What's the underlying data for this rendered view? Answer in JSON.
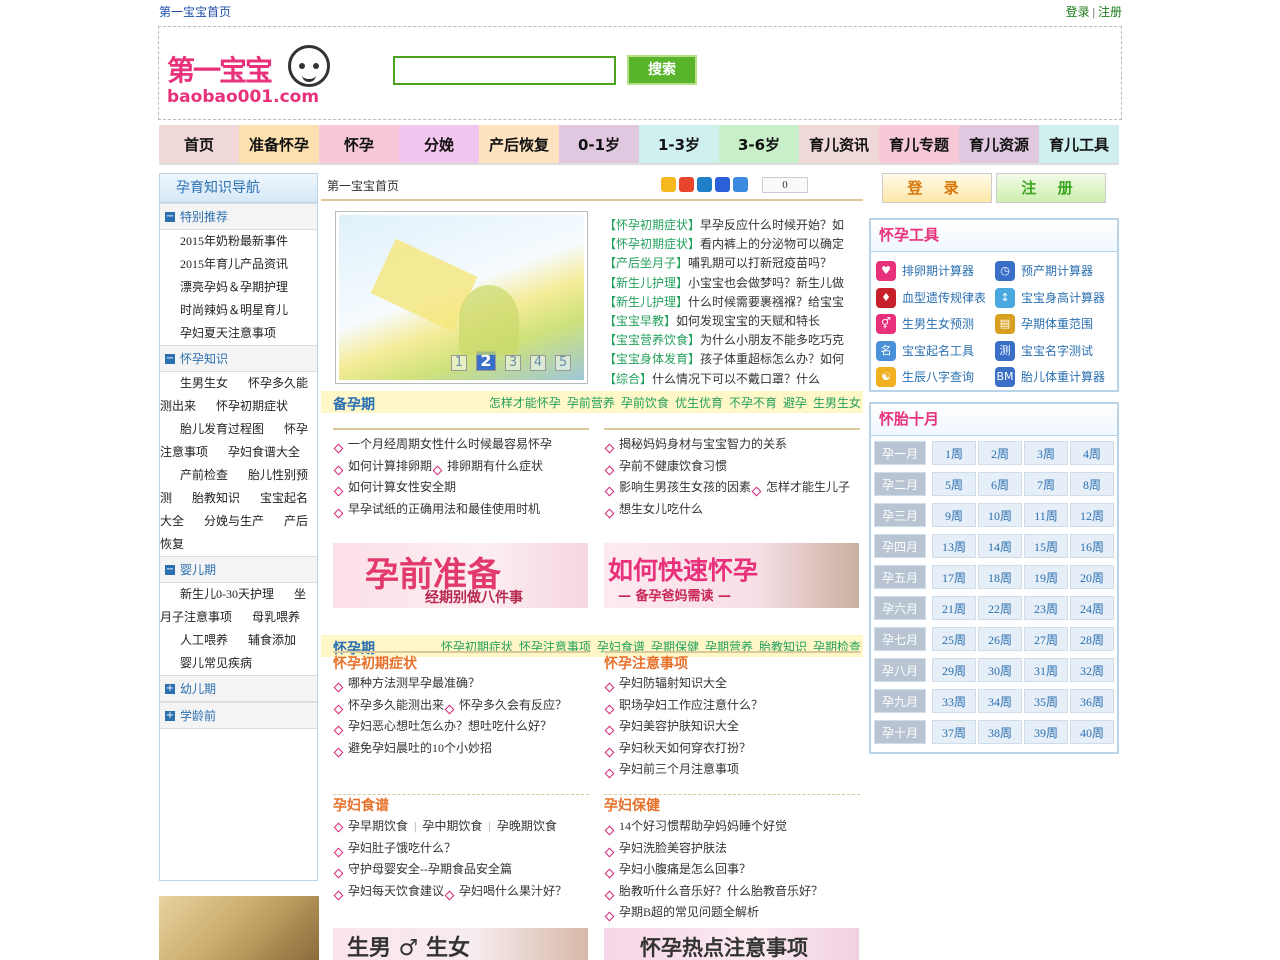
{
  "topbar": {
    "home": "第一宝宝首页",
    "login": "登录",
    "sep": "|",
    "register": "注册"
  },
  "logo": {
    "title": "第一宝宝",
    "domain": "baobao001.com"
  },
  "search": {
    "placeholder": "",
    "button": "搜索"
  },
  "nav": [
    {
      "label": "首页",
      "color": "#f0d8d8"
    },
    {
      "label": "准备怀孕",
      "color": "#fde0b0"
    },
    {
      "label": "怀孕",
      "color": "#f6c8d8"
    },
    {
      "label": "分娩",
      "color": "#f3c6ef"
    },
    {
      "label": "产后恢复",
      "color": "#fde3c0"
    },
    {
      "label": "0-1岁",
      "color": "#e0c8e0"
    },
    {
      "label": "1-3岁",
      "color": "#d0f0f0"
    },
    {
      "label": "3-6岁",
      "color": "#c8efc8"
    },
    {
      "label": "育儿资讯",
      "color": "#f0d8d8"
    },
    {
      "label": "育儿专题",
      "color": "#f6c8d8"
    },
    {
      "label": "育儿资源",
      "color": "#e0c8e0"
    },
    {
      "label": "育儿工具",
      "color": "#d0f0f0"
    }
  ],
  "leftnav": {
    "title": "孕育知识导航",
    "sections": [
      {
        "title": "特别推荐",
        "sign": "−",
        "items": [
          "2015年奶粉最新事件",
          "2015年育儿产品资讯",
          "漂亮孕妈＆孕期护理",
          "时尚辣妈＆明星育儿",
          "孕妇夏天注意事项"
        ]
      },
      {
        "title": "怀孕知识",
        "sign": "−",
        "items": [
          "生男生女",
          "怀孕多久能测出来",
          "怀孕初期症状",
          "胎儿发育过程图",
          "怀孕注意事项",
          "孕妇食谱大全",
          "产前检查",
          "胎儿性别预测",
          "胎教知识",
          "宝宝起名大全",
          "分娩与生产",
          "产后恢复"
        ]
      },
      {
        "title": "婴儿期",
        "sign": "−",
        "items": [
          "新生儿0-30天护理",
          "坐月子注意事项",
          "母乳喂养",
          "人工喂养",
          "辅食添加",
          "婴儿常见疾病"
        ]
      },
      {
        "title": "幼儿期",
        "sign": "+",
        "items": []
      },
      {
        "title": "学龄前",
        "sign": "+",
        "items": []
      }
    ]
  },
  "crumb": {
    "text": "第一宝宝首页",
    "share_count": "0"
  },
  "slider": {
    "dots": [
      "1",
      "2",
      "3",
      "4",
      "5"
    ],
    "active": "2"
  },
  "headlines": [
    {
      "tag": "【怀孕初期症状】",
      "text": "早孕反应什么时候开始？如"
    },
    {
      "tag": "【怀孕初期症状】",
      "text": "看内裤上的分泌物可以确定"
    },
    {
      "tag": "【产后坐月子】",
      "text": "哺乳期可以打新冠疫苗吗？"
    },
    {
      "tag": "【新生儿护理】",
      "text": "小宝宝也会做梦吗？新生儿做"
    },
    {
      "tag": "【新生儿护理】",
      "text": "什么时候需要裹襁褓？给宝宝"
    },
    {
      "tag": "【宝宝早教】",
      "text": "如何发现宝宝的天赋和特长"
    },
    {
      "tag": "【宝宝营养饮食】",
      "text": "为什么小朋友不能多吃巧克"
    },
    {
      "tag": "【宝宝身体发育】",
      "text": "孩子体重超标怎么办？如何"
    },
    {
      "tag": "【综合】",
      "text": "什么情况下可以不戴口罩？什么"
    }
  ],
  "prep": {
    "title": "备孕期",
    "links": [
      "怎样才能怀孕",
      "孕前营养",
      "孕前饮食",
      "优生优育",
      "不孕不育",
      "避孕",
      "生男生女"
    ],
    "left": [
      "一个月经周期女性什么时候最容易怀孕",
      "如何计算排卵期",
      "排卵期有什么症状",
      "如何计算女性安全期",
      "早孕试纸的正确用法和最佳使用时机"
    ],
    "right": [
      "揭秘妈妈身材与宝宝智力的关系",
      "孕前不健康饮食习惯",
      "影响生男孩生女孩的因素",
      "怎样才能生儿子",
      "想生女儿吃什么"
    ],
    "banner_left": {
      "title": "孕前准备",
      "sub": "经期别做八件事"
    },
    "banner_right": {
      "title": "如何快速怀孕",
      "sub": "— 备孕爸妈需读 —"
    }
  },
  "preg": {
    "title": "怀孕期",
    "links": [
      "怀孕初期症状",
      "怀孕注意事项",
      "孕妇食谱",
      "孕期保健",
      "孕期营养",
      "胎教知识",
      "孕期检查"
    ],
    "b1": {
      "title": "怀孕初期症状",
      "items": [
        "哪种方法测早孕最准确？",
        "怀孕多久能测出来",
        "怀孕多久会有反应？",
        "孕妇恶心想吐怎么办？想吐吃什么好？",
        "避免孕妇晨吐的10个小妙招"
      ]
    },
    "b2": {
      "title": "怀孕注意事项",
      "items": [
        "孕妇防辐射知识大全",
        "职场孕妇工作应注意什么？",
        "孕妇美容护肤知识大全",
        "孕妇秋天如何穿衣打扮？",
        "孕妇前三个月注意事项"
      ]
    },
    "b3": {
      "title": "孕妇食谱",
      "first": [
        "孕早期饮食",
        "孕中期饮食",
        "孕晚期饮食"
      ],
      "items": [
        "孕妇肚子饿吃什么？",
        "守护母婴安全--孕期食品安全篇",
        "孕妇每天饮食建议",
        "孕妇喝什么果汁好？"
      ]
    },
    "b4": {
      "title": "孕妇保健",
      "items": [
        "14个好习惯帮助孕妈妈睡个好觉",
        "孕妇洗脸美容护肤法",
        "孕妇小腹痛是怎么回事？",
        "胎教听什么音乐好？什么胎教音乐好？",
        "孕期B超的常见问题全解析"
      ]
    },
    "banner_left": {
      "title": "生男 ♂ 生女"
    },
    "banner_right": {
      "title": "怀孕热点注意事项"
    }
  },
  "right": {
    "login": "登 录",
    "register": "注 册",
    "tools_title": "怀孕工具",
    "tools": [
      {
        "label": "排卵期计算器",
        "icon": "heart-icon",
        "color": "#e8317a",
        "glyph": "♥"
      },
      {
        "label": "预产期计算器",
        "icon": "clock-icon",
        "color": "#3a6fc8",
        "glyph": "◷"
      },
      {
        "label": "血型遗传规律表",
        "icon": "blood-icon",
        "color": "#c8202a",
        "glyph": "♦"
      },
      {
        "label": "宝宝身高计算器",
        "icon": "height-icon",
        "color": "#4aa8e0",
        "glyph": "↕"
      },
      {
        "label": "生男生女预测",
        "icon": "gender-icon",
        "color": "#e8317a",
        "glyph": "⚥"
      },
      {
        "label": "孕期体重范围",
        "icon": "scale-icon",
        "color": "#d8a020",
        "glyph": "▤"
      },
      {
        "label": "宝宝起名工具",
        "icon": "name-icon",
        "color": "#4a90d8",
        "glyph": "名"
      },
      {
        "label": "宝宝名字测试",
        "icon": "test-icon",
        "color": "#3a6fc8",
        "glyph": "测"
      },
      {
        "label": "生辰八字查询",
        "icon": "bagua-icon",
        "color": "#f0b020",
        "glyph": "☯"
      },
      {
        "label": "胎儿体重计算器",
        "icon": "bmi-icon",
        "color": "#3a6fc8",
        "glyph": "BM"
      }
    ],
    "months_title": "怀胎十月",
    "months": [
      {
        "m": "孕一月",
        "w": [
          "1周",
          "2周",
          "3周",
          "4周"
        ]
      },
      {
        "m": "孕二月",
        "w": [
          "5周",
          "6周",
          "7周",
          "8周"
        ]
      },
      {
        "m": "孕三月",
        "w": [
          "9周",
          "10周",
          "11周",
          "12周"
        ]
      },
      {
        "m": "孕四月",
        "w": [
          "13周",
          "14周",
          "15周",
          "16周"
        ]
      },
      {
        "m": "孕五月",
        "w": [
          "17周",
          "18周",
          "19周",
          "20周"
        ]
      },
      {
        "m": "孕六月",
        "w": [
          "21周",
          "22周",
          "23周",
          "24周"
        ]
      },
      {
        "m": "孕七月",
        "w": [
          "25周",
          "26周",
          "27周",
          "28周"
        ]
      },
      {
        "m": "孕八月",
        "w": [
          "29周",
          "30周",
          "31周",
          "32周"
        ]
      },
      {
        "m": "孕九月",
        "w": [
          "33周",
          "34周",
          "35周",
          "36周"
        ]
      },
      {
        "m": "孕十月",
        "w": [
          "37周",
          "38周",
          "39周",
          "40周"
        ]
      }
    ]
  }
}
